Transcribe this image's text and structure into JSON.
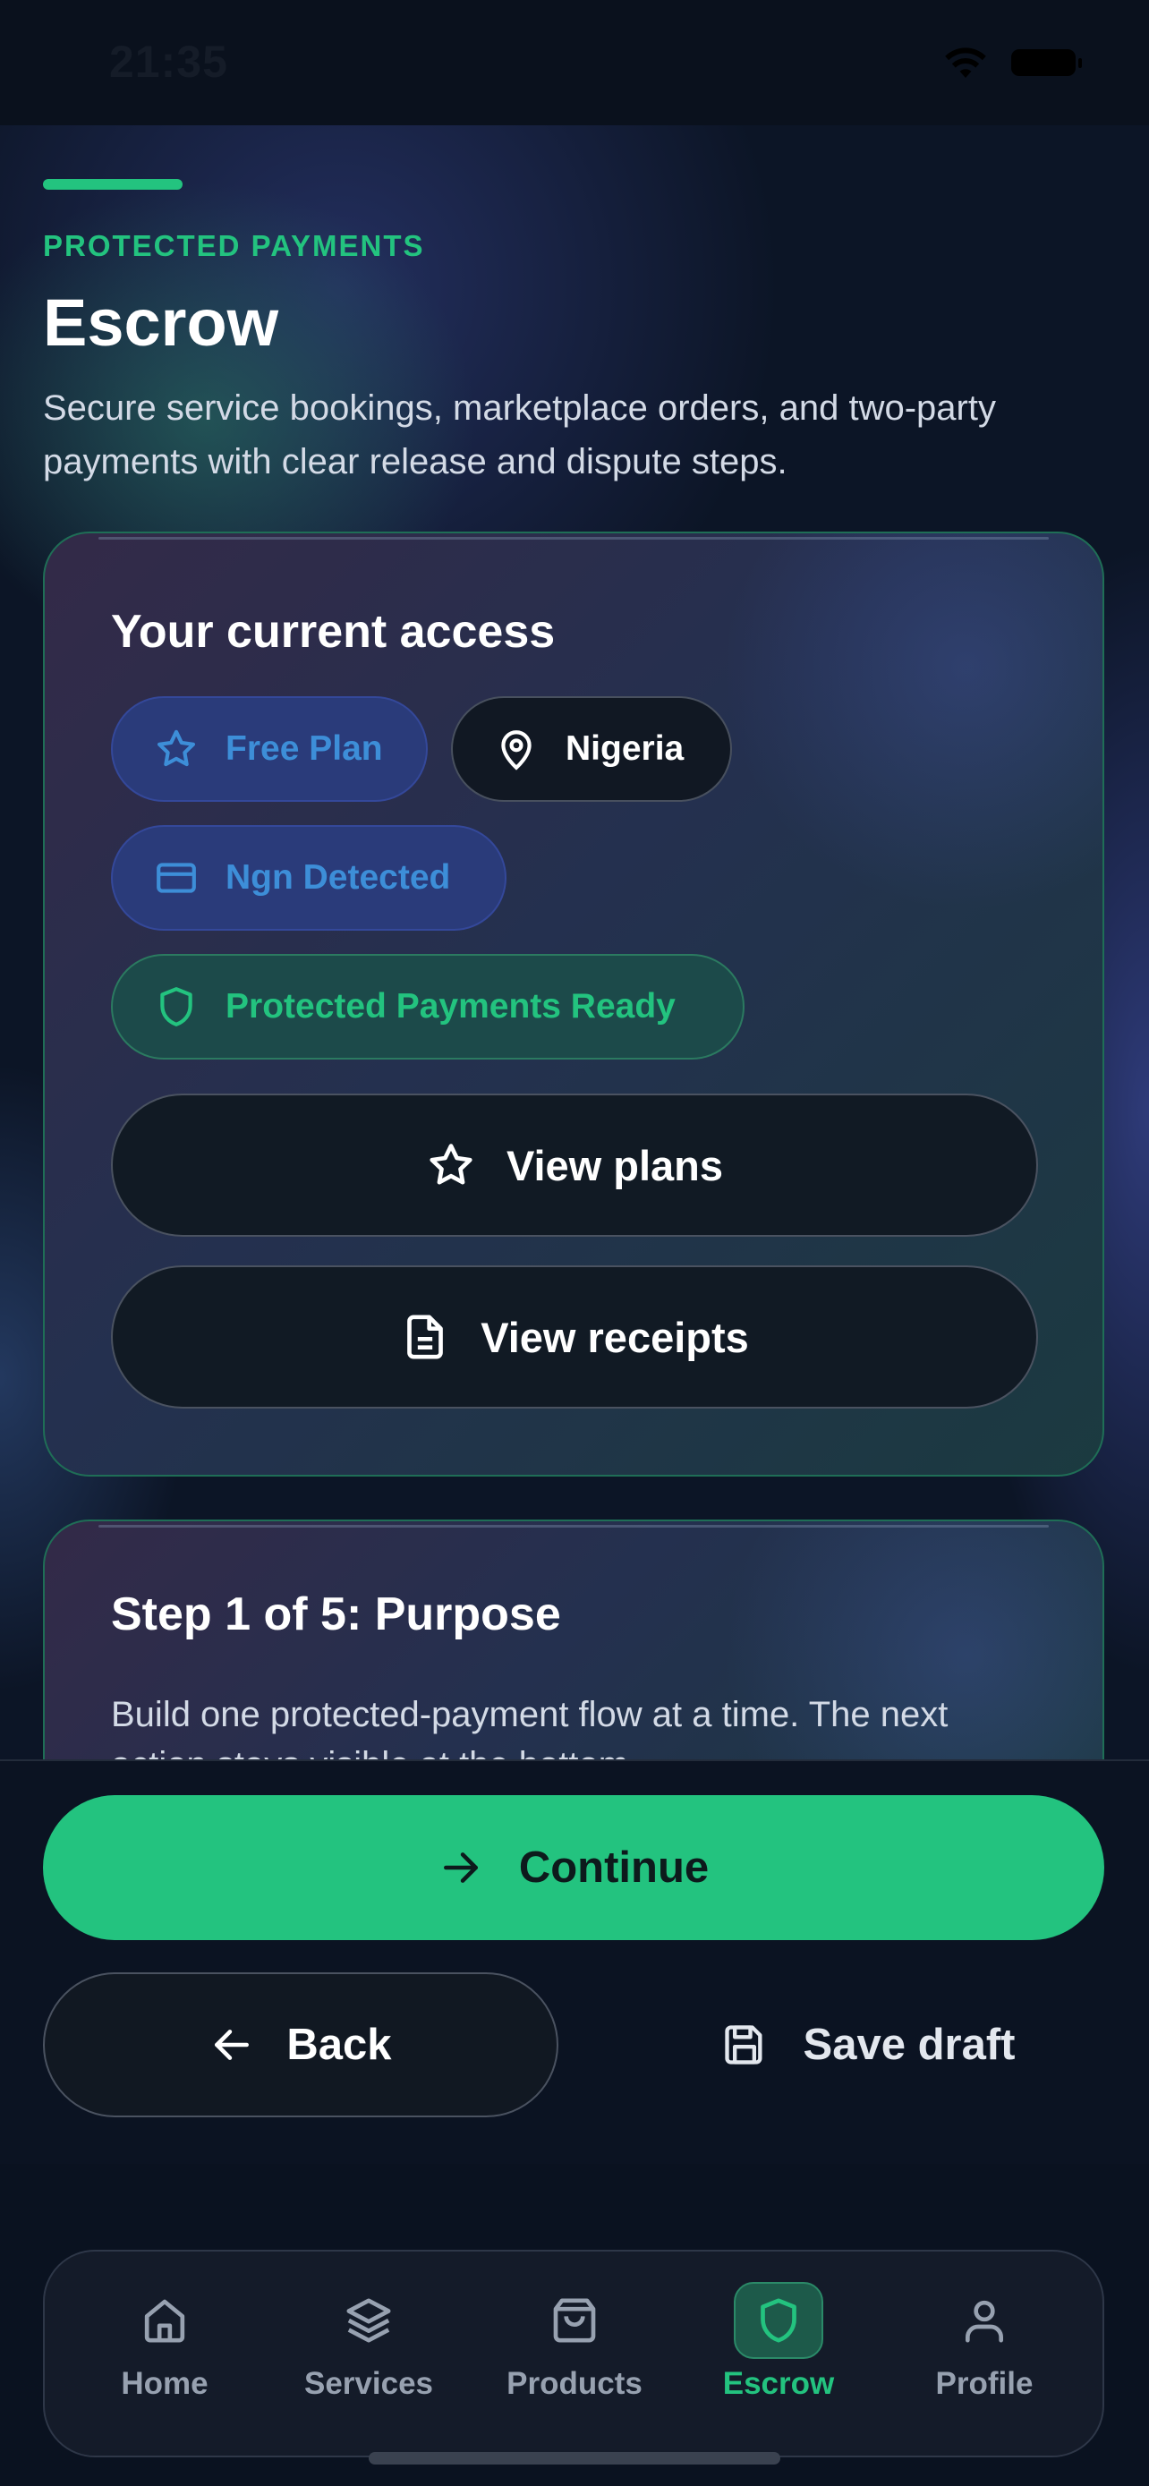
{
  "status_bar": {
    "time": "21:35"
  },
  "header": {
    "eyebrow": "PROTECTED PAYMENTS",
    "title": "Escrow",
    "description": "Secure service bookings, marketplace orders, and two-party payments with clear release and dispute steps."
  },
  "access_card": {
    "title": "Your current access",
    "chips": {
      "plan": "Free Plan",
      "country": "Nigeria",
      "currency": "Ngn Detected",
      "status": "Protected Payments Ready"
    },
    "view_plans_label": "View plans",
    "view_receipts_label": "View receipts"
  },
  "step_card": {
    "title": "Step 1 of 5: Purpose",
    "description": "Build one protected-payment flow at a time. The next action stays visible at the bottom."
  },
  "actions": {
    "continue_label": "Continue",
    "back_label": "Back",
    "save_draft_label": "Save draft"
  },
  "tabbar": {
    "items": [
      {
        "label": "Home",
        "icon": "home-icon"
      },
      {
        "label": "Services",
        "icon": "layers-icon"
      },
      {
        "label": "Products",
        "icon": "shopping-bag-icon"
      },
      {
        "label": "Escrow",
        "icon": "shield-icon",
        "active": true
      },
      {
        "label": "Profile",
        "icon": "user-icon"
      }
    ]
  },
  "colors": {
    "accent": "#23c37f",
    "chip_blue_text": "#3d8ed8",
    "background": "#0a1220"
  }
}
